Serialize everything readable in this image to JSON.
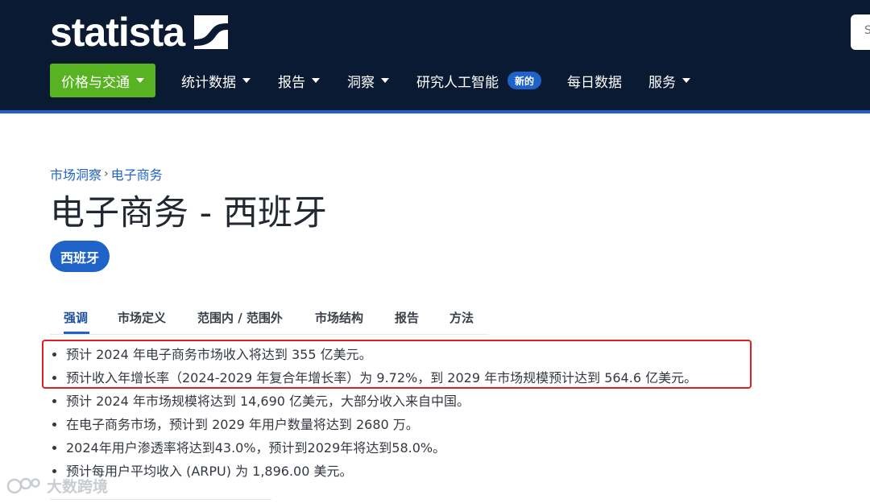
{
  "header": {
    "logo_text": "statista",
    "search_placeholder": "S",
    "nav": [
      {
        "label": "价格与交通",
        "active": true,
        "caret": true
      },
      {
        "label": "统计数据",
        "caret": true
      },
      {
        "label": "报告",
        "caret": true
      },
      {
        "label": "洞察",
        "caret": true
      },
      {
        "label": "研究人工智能",
        "badge": "新的"
      },
      {
        "label": "每日数据"
      },
      {
        "label": "服务",
        "caret": true
      }
    ]
  },
  "breadcrumb": {
    "items": [
      "市场洞察",
      "电子商务"
    ],
    "separator": "›"
  },
  "page_title": "电子商务 - 西班牙",
  "country_tag": "西班牙",
  "tabs": [
    "强调",
    "市场定义",
    "范围内 / 范围外",
    "市场结构",
    "报告",
    "方法"
  ],
  "highlights": [
    "预计 2024 年电子商务市场收入将达到 355 亿美元。",
    "预计收入年增长率（2024-2029 年复合年增长率）为 9.72%，到 2029 年市场规模预计达到 564.6 亿美元。",
    "预计 2024 年市场规模将达到 14,690 亿美元，大部分收入来自中国。",
    "在电子商务市场，预计到 2029 年用户数量将达到 2680 万。",
    "2024年用户渗透率将达到43.0%，预计到2029年将达到58.0%。",
    "预计每用户平均收入 (ARPU) 为 1,896.00 美元。"
  ],
  "watermark": "大数跨境",
  "colors": {
    "header_bg": "#0a1a33",
    "accent_blue": "#1f63c8",
    "active_nav_green": "#58b323",
    "highlight_box_red": "#e02020"
  }
}
